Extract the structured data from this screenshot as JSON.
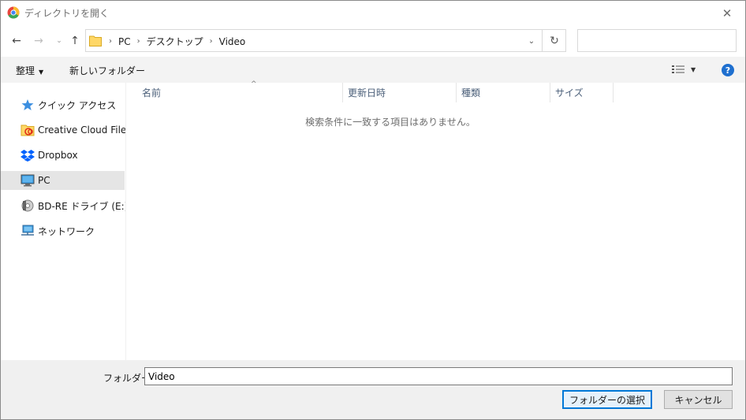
{
  "window": {
    "title": "ディレクトリを開く",
    "close_glyph": "✕"
  },
  "nav": {
    "back_glyph": "←",
    "forward_glyph": "→",
    "history_glyph": "⌄",
    "up_glyph": "↑",
    "breadcrumbs": [
      "PC",
      "デスクトップ",
      "Video"
    ],
    "breadcrumb_sep": "›",
    "dropdown_glyph": "⌄",
    "refresh_glyph": "↻",
    "search_placeholder": ""
  },
  "toolbar": {
    "organize_label": "整理",
    "organize_caret": "▼",
    "new_folder_label": "新しいフォルダー",
    "view_caret": "▼",
    "help_label": "?"
  },
  "sidebar": {
    "items": [
      {
        "label": "クイック アクセス",
        "icon": "star-icon"
      },
      {
        "label": "Creative Cloud Files",
        "icon": "creative-cloud-folder-icon"
      },
      {
        "label": "Dropbox",
        "icon": "dropbox-icon"
      },
      {
        "label": "PC",
        "icon": "computer-icon",
        "selected": true
      },
      {
        "label": "BD-RE ドライブ (E:) DVD",
        "icon": "disc-drive-icon"
      },
      {
        "label": "ネットワーク",
        "icon": "network-icon"
      }
    ]
  },
  "main": {
    "columns": [
      "名前",
      "更新日時",
      "種類",
      "サイズ"
    ],
    "sort_glyph": "^",
    "empty_message": "検索条件に一致する項目はありません。"
  },
  "footer": {
    "folder_label": "フォルダー:",
    "folder_value": "Video",
    "select_button": "フォルダーの選択",
    "cancel_button": "キャンセル"
  },
  "colors": {
    "accent": "#0078d7",
    "help": "#1e6fcf",
    "selected_bg": "#e5e5e5",
    "header_text": "#4c607a"
  }
}
